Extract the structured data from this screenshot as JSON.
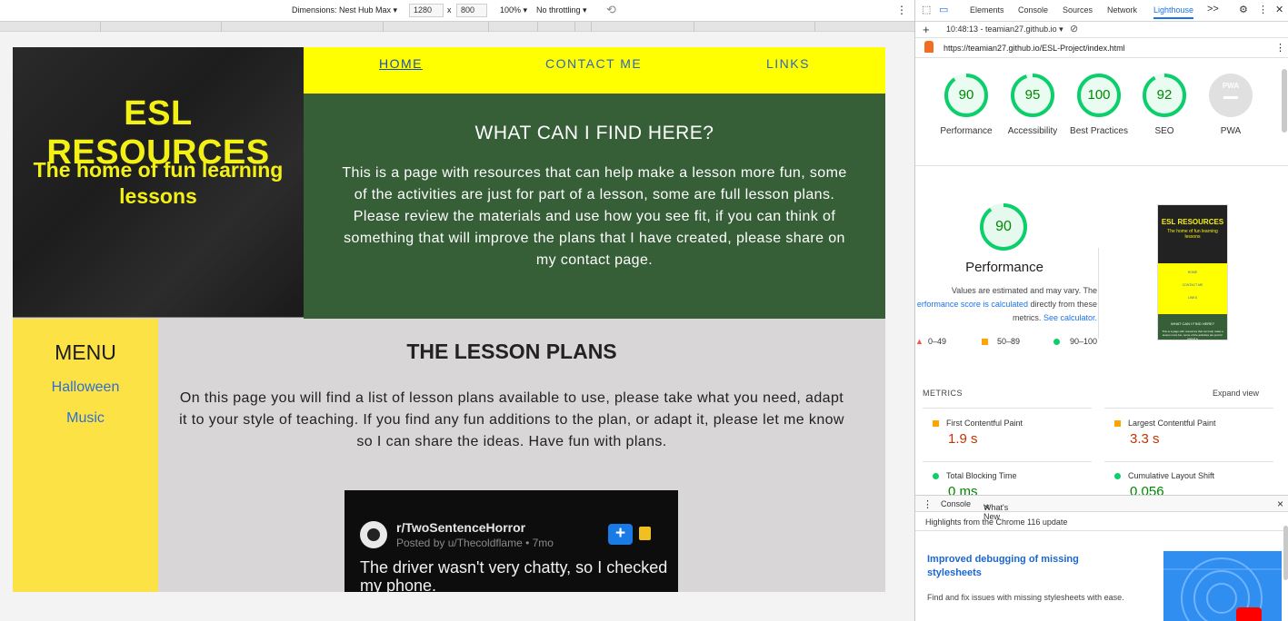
{
  "device_toolbar": {
    "dimensions_label": "Dimensions: Nest Hub Max",
    "width": "1280",
    "times": "x",
    "height": "800",
    "zoom": "100%",
    "throttling": "No throttling"
  },
  "site": {
    "brand_title": "ESL RESOURCES",
    "brand_subtitle": "The home of fun learning lessons",
    "nav": [
      "HOME",
      "CONTACT ME",
      "LINKS"
    ],
    "intro_heading": "WHAT CAN I FIND HERE?",
    "intro_text": "This is a page with resources that can help make a lesson more fun, some of the activities are just for part of a lesson, some are full lesson plans. Please review the materials and use how you see fit, if you can think of something that will improve the plans that I have created, please share on my contact page.",
    "menu_title": "MENU",
    "menu_items": [
      "Halloween",
      "Music"
    ],
    "lessons_heading": "THE LESSON PLANS",
    "lessons_text": "On this page you will find a list of lesson plans available to use, please take what you need, adapt it to your style of teaching. If you find any fun additions to the plan, or adapt it, please let me know so I can share the ideas. Have fun with plans.",
    "post": {
      "subreddit": "r/TwoSentenceHorror",
      "posted_by": "Posted by u/Thecoldflame • 7mo",
      "plus": "+",
      "text": "The driver wasn't very chatty, so I checked my phone."
    }
  },
  "devtools": {
    "tabs": [
      "Elements",
      "Console",
      "Sources",
      "Network",
      "Lighthouse"
    ],
    "more_tabs": ">>",
    "report_time": "10:48:13 - teamian27.github.io",
    "url": "https://teamian27.github.io/ESL-Project/index.html",
    "scores": [
      {
        "label": "Performance",
        "value": "90"
      },
      {
        "label": "Accessibility",
        "value": "95"
      },
      {
        "label": "Best Practices",
        "value": "100"
      },
      {
        "label": "SEO",
        "value": "92"
      },
      {
        "label": "PWA",
        "value": ""
      }
    ],
    "pwa_badge": "PWA",
    "perf": {
      "score": "90",
      "title": "Performance",
      "note_1": "Values are estimated and may vary. The",
      "note_link": "erformance score is calculated",
      "note_2": "directly from these",
      "note_3": "metrics.",
      "calc_link": "See calculator.",
      "legend": [
        "0–49",
        "50–89",
        "90–100"
      ]
    },
    "thumb": {
      "title": "ESL RESOURCES",
      "subtitle": "The home of fun learning lessons",
      "nav": [
        "HOME",
        "CONTACT ME",
        "LINKS"
      ],
      "heading": "WHAT CAN I FIND HERE?",
      "text": "This is a page with resources that can help make a lesson more fun, some of the activities are just for part of a"
    },
    "metrics_title": "METRICS",
    "expand": "Expand view",
    "metrics": [
      {
        "name": "First Contentful Paint",
        "value": "1.9 s",
        "status": "average"
      },
      {
        "name": "Largest Contentful Paint",
        "value": "3.3 s",
        "status": "average"
      },
      {
        "name": "Total Blocking Time",
        "value": "0 ms",
        "status": "pass"
      },
      {
        "name": "Cumulative Layout Shift",
        "value": "0.056",
        "status": "pass"
      }
    ],
    "drawer": {
      "tabs": [
        "Console",
        "What's New"
      ],
      "close": "×",
      "highlights": "Highlights from the Chrome 116 update",
      "article_title": "Improved debugging of missing stylesheets",
      "article_text": "Find and fix issues with missing stylesheets with ease."
    }
  },
  "colors": {
    "brand_yellow": "#f3f015",
    "nav_yellow": "#ffff00",
    "intro_green": "#365f38",
    "menu_yellow": "#fde246",
    "gauge_green": "#0cce6b",
    "gauge_orange": "#ffa400",
    "gauge_red": "#ff4e42"
  }
}
